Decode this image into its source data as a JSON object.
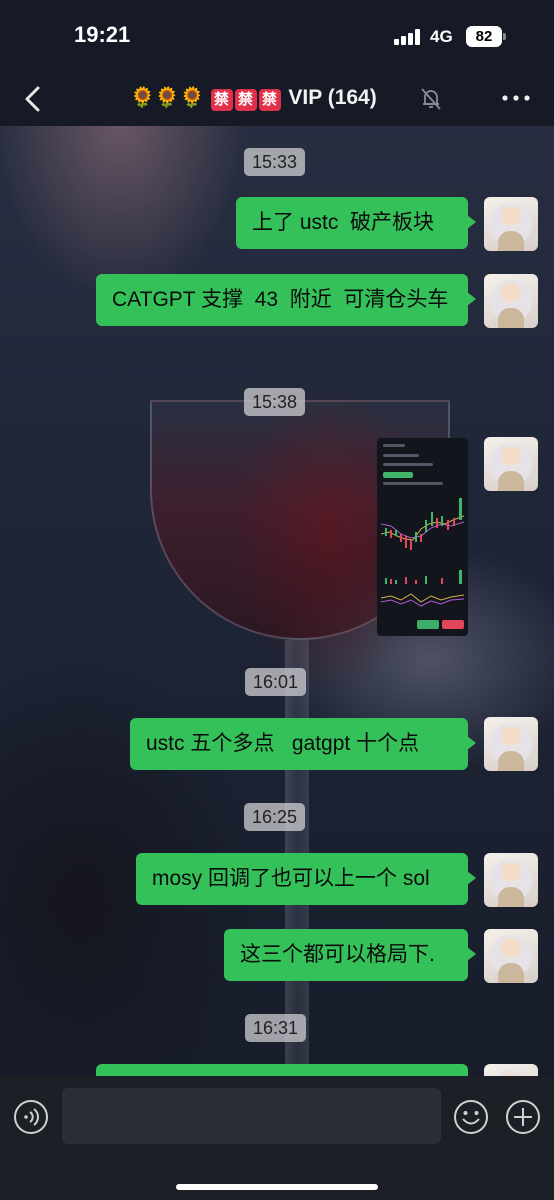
{
  "status_bar": {
    "time": "19:21",
    "network": "4G",
    "battery": "82"
  },
  "header": {
    "title_emoji": "🌻🌻🌻",
    "title_ban": [
      "禁",
      "禁",
      "禁"
    ],
    "title_text": "VIP (164)",
    "icons": {
      "back": "chevron-left-icon",
      "mute": "bell-muted-icon",
      "more": "more-dots-icon"
    }
  },
  "chat": {
    "messages": [
      {
        "type": "time",
        "text": "15:33"
      },
      {
        "type": "text",
        "sender": "self",
        "text": "上了 ustc  破产板块"
      },
      {
        "type": "text",
        "sender": "self",
        "text": "CATGPT 支撑  43  附近  可清仓头车"
      },
      {
        "type": "time",
        "text": "15:38"
      },
      {
        "type": "image",
        "sender": "self",
        "description": "USTC/USDT chart screenshot"
      },
      {
        "type": "time",
        "text": "16:01"
      },
      {
        "type": "text",
        "sender": "self",
        "text": "ustc 五个多点   gatgpt 十个点"
      },
      {
        "type": "time",
        "text": "16:25"
      },
      {
        "type": "text",
        "sender": "self",
        "text": "mosy 回调了也可以上一个 sol"
      },
      {
        "type": "text",
        "sender": "self",
        "text": "这三个都可以格局下."
      },
      {
        "type": "time",
        "text": "16:31"
      }
    ]
  },
  "input_bar": {
    "placeholder": "",
    "icons": {
      "voice": "voice-icon",
      "emoji": "emoji-icon",
      "plus": "plus-icon"
    }
  },
  "colors": {
    "bubble_self": "#35c15a",
    "header_bg": "#151a26",
    "input_bg": "#1c1f26"
  }
}
